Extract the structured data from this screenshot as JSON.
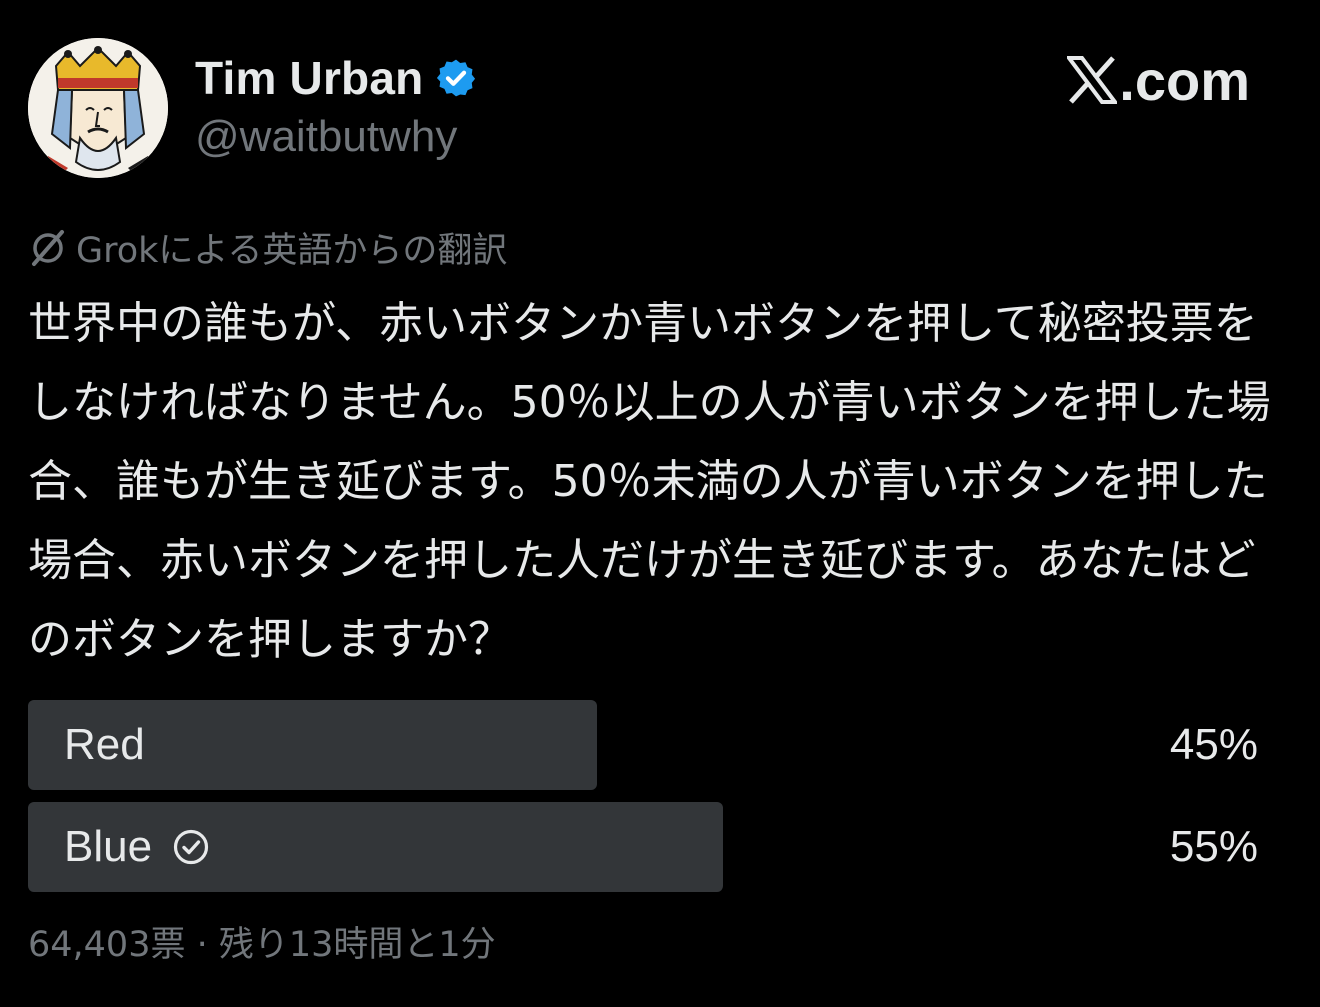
{
  "author": {
    "display_name": "Tim Urban",
    "handle": "@waitbutwhy",
    "avatar_icon": "king-of-spades-card-avatar",
    "verified_icon": "verified-badge-icon",
    "verified_color": "#1d9bf0"
  },
  "brand": {
    "icon": "x-logo-icon",
    "text": ".com"
  },
  "translation": {
    "icon": "grok-icon",
    "note": "Grokによる英語からの翻訳"
  },
  "tweet": {
    "text": "世界中の誰もが、赤いボタンか青いボタンを押して秘密投票をしなければなりません。50％以上の人が青いボタンを押した場合、誰もが生き延びます。50％未満の人が青いボタンを押した場合、赤いボタンを押した人だけが生き延びます。あなたはどのボタンを押しますか？"
  },
  "poll": {
    "options": [
      {
        "label": "Red",
        "percent_text": "45%",
        "share": 0.45,
        "selected": false
      },
      {
        "label": "Blue",
        "percent_text": "55%",
        "share": 0.55,
        "selected": true,
        "selected_icon": "check-circle-icon"
      }
    ],
    "meta": "64,403票 · 残り13時間と1分"
  },
  "colors": {
    "background": "#000000",
    "primary_text": "#e7e9ea",
    "secondary_text": "#71767b",
    "poll_bar": "#333639"
  }
}
